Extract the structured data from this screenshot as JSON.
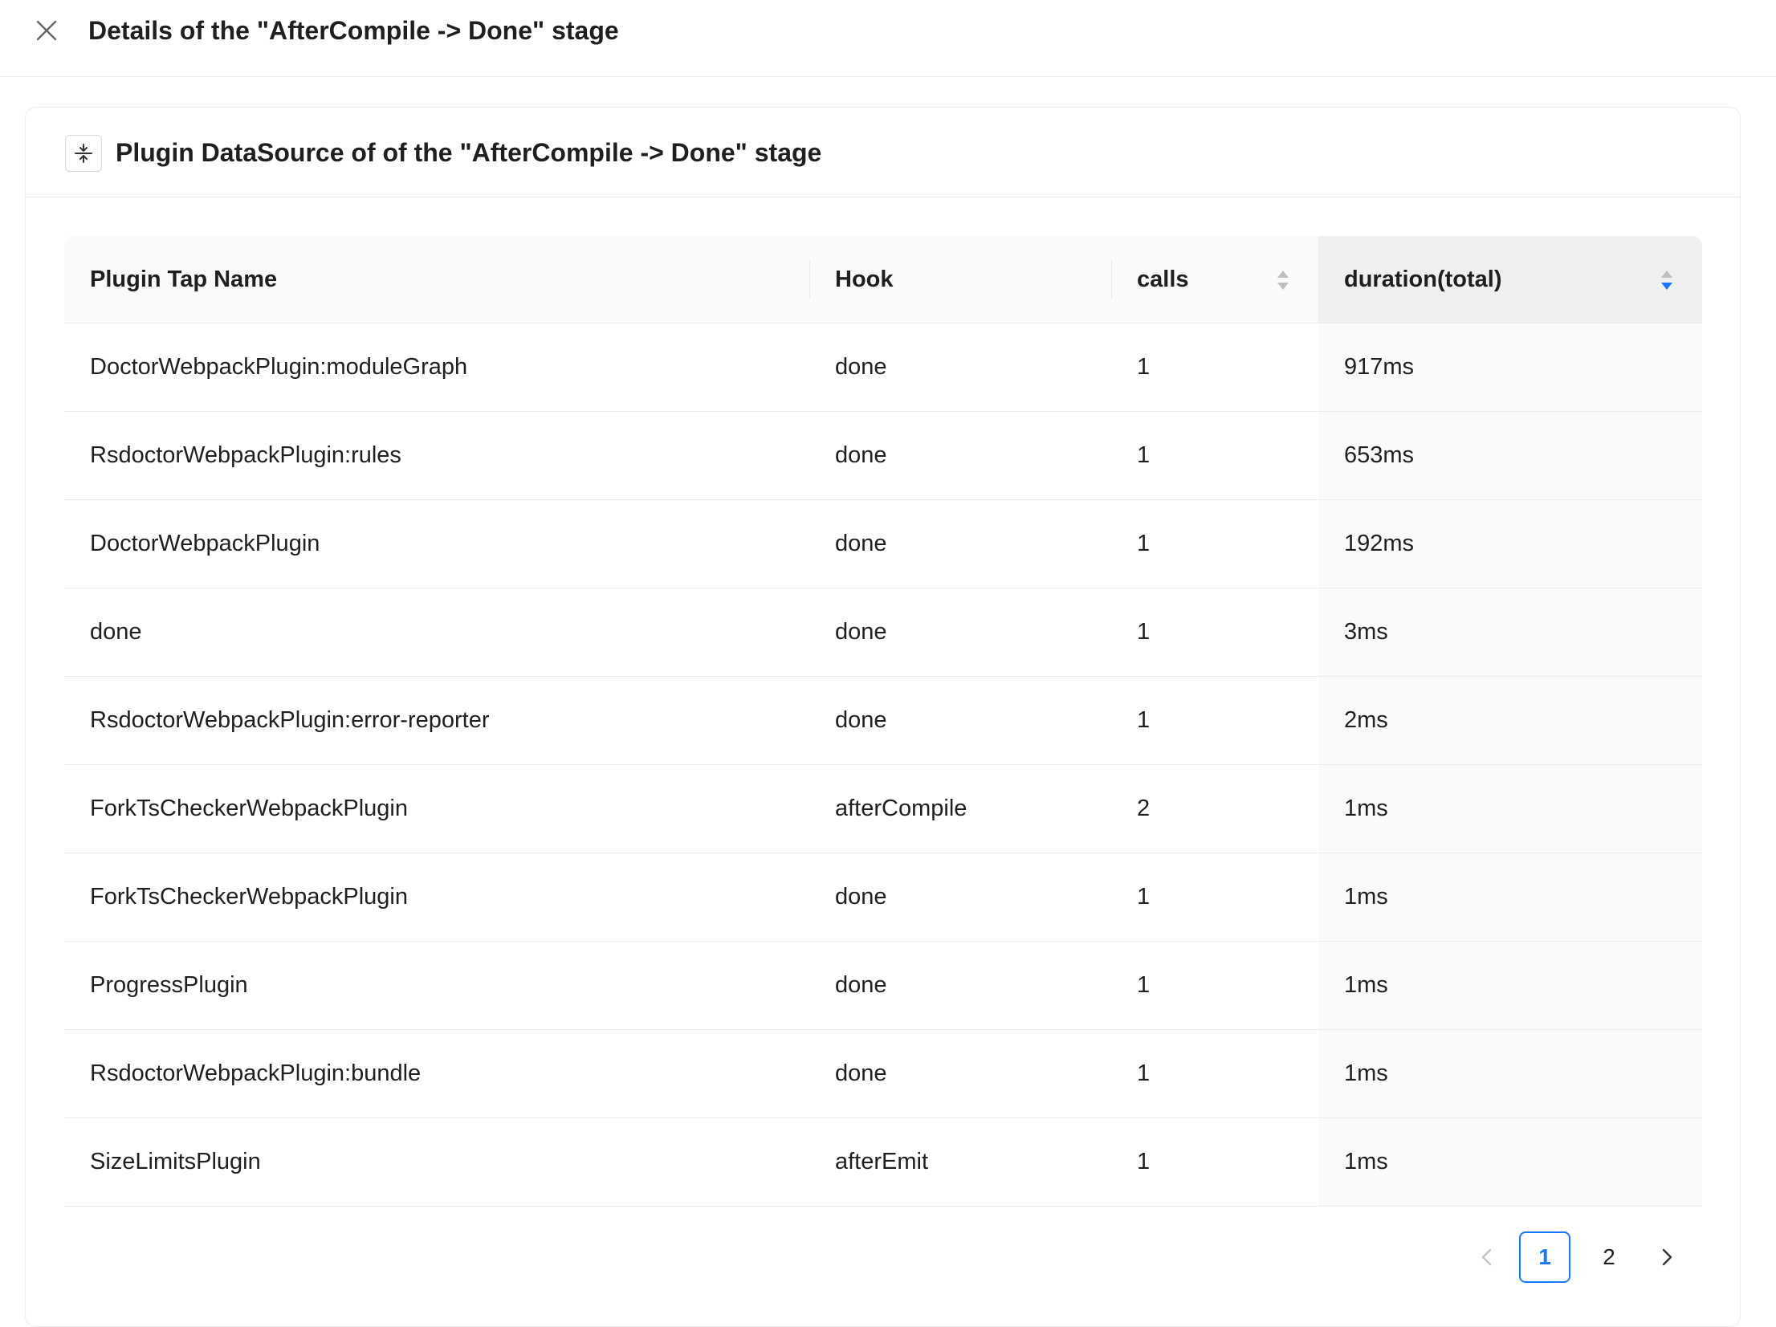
{
  "header": {
    "title": "Details of the \"AfterCompile -> Done\" stage"
  },
  "card": {
    "title": "Plugin DataSource of of the \"AfterCompile -> Done\" stage"
  },
  "table": {
    "columns": [
      "Plugin Tap Name",
      "Hook",
      "calls",
      "duration(total)"
    ],
    "sort": {
      "column": "duration(total)",
      "direction": "descending"
    },
    "rows": [
      [
        "DoctorWebpackPlugin:moduleGraph",
        "done",
        "1",
        "917ms"
      ],
      [
        "RsdoctorWebpackPlugin:rules",
        "done",
        "1",
        "653ms"
      ],
      [
        "DoctorWebpackPlugin",
        "done",
        "1",
        "192ms"
      ],
      [
        "done",
        "done",
        "1",
        "3ms"
      ],
      [
        "RsdoctorWebpackPlugin:error-reporter",
        "done",
        "1",
        "2ms"
      ],
      [
        "ForkTsCheckerWebpackPlugin",
        "afterCompile",
        "2",
        "1ms"
      ],
      [
        "ForkTsCheckerWebpackPlugin",
        "done",
        "1",
        "1ms"
      ],
      [
        "ProgressPlugin",
        "done",
        "1",
        "1ms"
      ],
      [
        "RsdoctorWebpackPlugin:bundle",
        "done",
        "1",
        "1ms"
      ],
      [
        "SizeLimitsPlugin",
        "afterEmit",
        "1",
        "1ms"
      ]
    ]
  },
  "pagination": {
    "pages": [
      "1",
      "2"
    ],
    "current": "1"
  },
  "colors": {
    "accent": "#1677ff",
    "border": "#ececec",
    "header_bg": "#fafafa"
  }
}
